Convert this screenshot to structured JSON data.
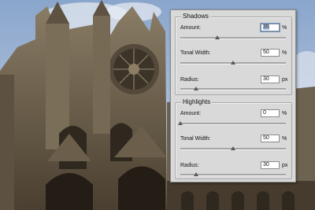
{
  "shadows": {
    "title": "Shadows",
    "amount": {
      "label": "Amount:",
      "value": "35",
      "unit": "%",
      "level": 0.35
    },
    "tonal_width": {
      "label": "Tonal Width:",
      "value": "50",
      "unit": "%",
      "level": 0.5
    },
    "radius": {
      "label": "Radius:",
      "value": "30",
      "unit": "px",
      "level": 0.15
    }
  },
  "highlights": {
    "title": "Highlights",
    "amount": {
      "label": "Amount:",
      "value": "0",
      "unit": "%",
      "level": 0.0
    },
    "tonal_width": {
      "label": "Tonal Width:",
      "value": "50",
      "unit": "%",
      "level": 0.5
    },
    "radius": {
      "label": "Radius:",
      "value": "30",
      "unit": "px",
      "level": 0.15
    }
  }
}
